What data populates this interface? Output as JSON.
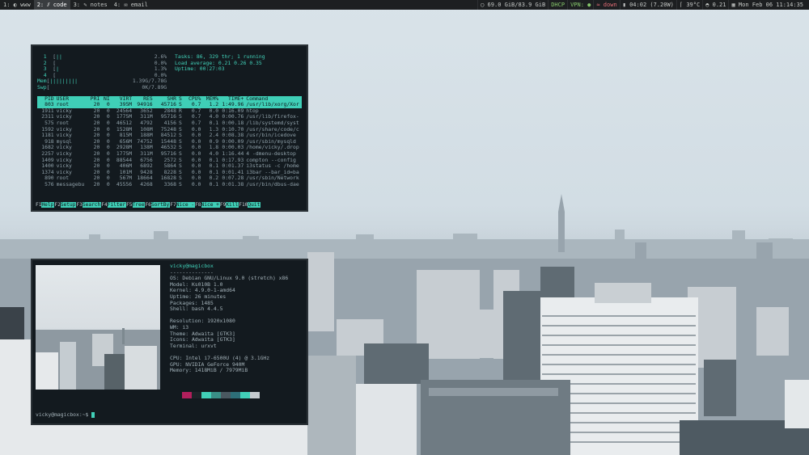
{
  "workspaces": [
    {
      "label": "1: ◐ www",
      "active": false
    },
    {
      "label": "2: ⫽ code",
      "active": true
    },
    {
      "label": "3: ✎ notes",
      "active": false
    },
    {
      "label": "4: ✉ email",
      "active": false
    }
  ],
  "status": {
    "disk": "69.0 GiB/83.9 GiB",
    "net": "DHCP",
    "vpn": "VPN: ●",
    "wifi": "down",
    "battery": "04:02 (7.20W)",
    "temp": "39°C",
    "load": "0.21",
    "datetime": "Mon Feb 06 11:14:35"
  },
  "htop": {
    "cpus": [
      {
        "n": "1",
        "bar": "||",
        "pct": "2.6%"
      },
      {
        "n": "2",
        "bar": "",
        "pct": "0.0%"
      },
      {
        "n": "3",
        "bar": "|",
        "pct": "1.3%"
      },
      {
        "n": "4",
        "bar": "",
        "pct": "0.0%"
      }
    ],
    "mem": {
      "label": "Mem",
      "bar": "|||||||||",
      "val": "1.39G/7.78G"
    },
    "swp": {
      "label": "Swp",
      "bar": "",
      "val": "0K/7.89G"
    },
    "tasks": "Tasks: 86, 329 thr; 1 running",
    "load": "Load average: 0.21 0.26 0.35",
    "uptime": "Uptime: 00:27:03",
    "columns": [
      "PID",
      "USER",
      "PRI",
      "NI",
      "VIRT",
      "RES",
      "SHR",
      "S",
      "CPU%",
      "MEM%",
      "TIME+",
      "Command"
    ],
    "rows": [
      [
        "803",
        "root",
        "20",
        "0",
        "395M",
        "94916",
        "45716",
        "S",
        "0.7",
        "1.2",
        "1:49.96",
        "/usr/lib/xorg/Xor"
      ],
      [
        "1911",
        "vicky",
        "20",
        "0",
        "24564",
        "3652",
        "2848",
        "R",
        "0.7",
        "0.0",
        "0:16.09",
        "htop"
      ],
      [
        "2311",
        "vicky",
        "20",
        "0",
        "1775M",
        "311M",
        "95716",
        "S",
        "0.7",
        "4.0",
        "0:00.76",
        "/usr/lib/firefox-"
      ],
      [
        "575",
        "root",
        "20",
        "0",
        "46512",
        "4792",
        "4156",
        "S",
        "0.7",
        "0.1",
        "0:00.18",
        "/lib/systemd/syst"
      ],
      [
        "1592",
        "vicky",
        "20",
        "0",
        "1528M",
        "108M",
        "75248",
        "S",
        "0.0",
        "1.3",
        "0:10.70",
        "/usr/share/code/c"
      ],
      [
        "1181",
        "vicky",
        "20",
        "0",
        "815M",
        "188M",
        "84512",
        "S",
        "0.0",
        "2.4",
        "0:08.38",
        "/usr/bin/icedove"
      ],
      [
        "918",
        "mysql",
        "20",
        "0",
        "656M",
        "74752",
        "15448",
        "S",
        "0.0",
        "0.9",
        "0:00.09",
        "/usr/sbin/mysqld"
      ],
      [
        "1682",
        "vicky",
        "20",
        "0",
        "2928M",
        "138M",
        "46532",
        "S",
        "0.0",
        "1.8",
        "0:00.03",
        "/home/vicky/.drop"
      ],
      [
        "2257",
        "vicky",
        "20",
        "0",
        "1775M",
        "311M",
        "95716",
        "S",
        "0.0",
        "4.0",
        "1:16.44",
        "4 -dmenu-desktop"
      ],
      [
        "1409",
        "vicky",
        "20",
        "0",
        "88544",
        "6756",
        "2572",
        "S",
        "0.0",
        "0.1",
        "0:17.93",
        "compton --config"
      ],
      [
        "1400",
        "vicky",
        "20",
        "0",
        "406M",
        "6892",
        "5864",
        "S",
        "0.0",
        "0.1",
        "0:01.37",
        "i3status -c /home"
      ],
      [
        "1374",
        "vicky",
        "20",
        "0",
        "101M",
        "9428",
        "8228",
        "S",
        "0.0",
        "0.1",
        "0:01.41",
        "i3bar --bar_id=ba"
      ],
      [
        "890",
        "root",
        "20",
        "0",
        "567M",
        "18664",
        "16828",
        "S",
        "0.0",
        "0.2",
        "0:07.28",
        "/usr/sbin/Network"
      ],
      [
        "576",
        "messagebu",
        "20",
        "0",
        "45556",
        "4268",
        "3368",
        "S",
        "0.0",
        "0.1",
        "0:01.38",
        "/usr/bin/dbus-dae"
      ]
    ],
    "fkeys": [
      {
        "key": "F1",
        "label": "Help"
      },
      {
        "key": "F2",
        "label": "Setup"
      },
      {
        "key": "F3",
        "label": "Search"
      },
      {
        "key": "F4",
        "label": "Filter"
      },
      {
        "key": "F5",
        "label": "Tree"
      },
      {
        "key": "F6",
        "label": "SortBy"
      },
      {
        "key": "F7",
        "label": "Nice -"
      },
      {
        "key": "F8",
        "label": "Nice +"
      },
      {
        "key": "F9",
        "label": "Kill"
      },
      {
        "key": "F10",
        "label": "Quit"
      }
    ]
  },
  "neofetch": {
    "title": "vicky@magicbox",
    "sep": "--------------",
    "info": [
      {
        "k": "OS",
        "v": "Debian GNU/Linux 9.0 (stretch) x86"
      },
      {
        "k": "Model",
        "v": "Ks010B 1.0"
      },
      {
        "k": "Kernel",
        "v": "4.9.0-1-amd64"
      },
      {
        "k": "Uptime",
        "v": "26 minutes"
      },
      {
        "k": "Packages",
        "v": "1485"
      },
      {
        "k": "Shell",
        "v": "bash 4.4.5"
      },
      {
        "k": "",
        "v": ""
      },
      {
        "k": "Resolution",
        "v": "1920x1080"
      },
      {
        "k": "WM",
        "v": "i3"
      },
      {
        "k": "Theme",
        "v": "Adwaita [GTK3]"
      },
      {
        "k": "Icons",
        "v": "Adwaita [GTK3]"
      },
      {
        "k": "Terminal",
        "v": "urxvt"
      },
      {
        "k": "",
        "v": ""
      },
      {
        "k": "CPU",
        "v": "Intel i7-6500U (4) @ 3.1GHz"
      },
      {
        "k": "GPU",
        "v": "NVIDIA GeForce 940M"
      },
      {
        "k": "Memory",
        "v": "1418MiB / 7979MiB"
      }
    ],
    "swatches": [
      "#b21f5c",
      "#1c2428",
      "#41d0b8",
      "#3a8f87",
      "#4a5860",
      "#2d6f78",
      "#41d0b8",
      "#c5cbcf"
    ],
    "prompt": "vicky@magicbox:~$ "
  }
}
